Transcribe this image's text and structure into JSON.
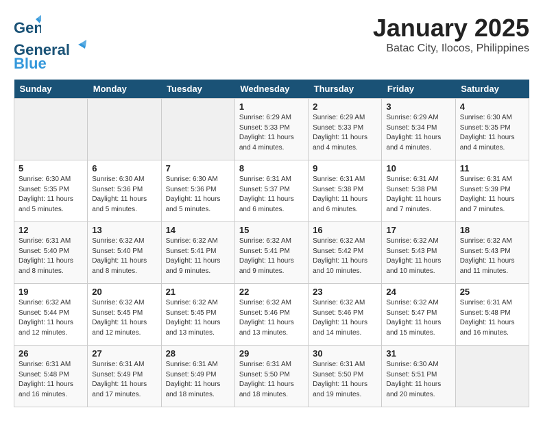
{
  "header": {
    "logo_line1": "General",
    "logo_line2": "Blue",
    "title": "January 2025",
    "subtitle": "Batac City, Ilocos, Philippines"
  },
  "weekdays": [
    "Sunday",
    "Monday",
    "Tuesday",
    "Wednesday",
    "Thursday",
    "Friday",
    "Saturday"
  ],
  "weeks": [
    [
      {
        "day": "",
        "info": ""
      },
      {
        "day": "",
        "info": ""
      },
      {
        "day": "",
        "info": ""
      },
      {
        "day": "1",
        "info": "Sunrise: 6:29 AM\nSunset: 5:33 PM\nDaylight: 11 hours\nand 4 minutes."
      },
      {
        "day": "2",
        "info": "Sunrise: 6:29 AM\nSunset: 5:33 PM\nDaylight: 11 hours\nand 4 minutes."
      },
      {
        "day": "3",
        "info": "Sunrise: 6:29 AM\nSunset: 5:34 PM\nDaylight: 11 hours\nand 4 minutes."
      },
      {
        "day": "4",
        "info": "Sunrise: 6:30 AM\nSunset: 5:35 PM\nDaylight: 11 hours\nand 4 minutes."
      }
    ],
    [
      {
        "day": "5",
        "info": "Sunrise: 6:30 AM\nSunset: 5:35 PM\nDaylight: 11 hours\nand 5 minutes."
      },
      {
        "day": "6",
        "info": "Sunrise: 6:30 AM\nSunset: 5:36 PM\nDaylight: 11 hours\nand 5 minutes."
      },
      {
        "day": "7",
        "info": "Sunrise: 6:30 AM\nSunset: 5:36 PM\nDaylight: 11 hours\nand 5 minutes."
      },
      {
        "day": "8",
        "info": "Sunrise: 6:31 AM\nSunset: 5:37 PM\nDaylight: 11 hours\nand 6 minutes."
      },
      {
        "day": "9",
        "info": "Sunrise: 6:31 AM\nSunset: 5:38 PM\nDaylight: 11 hours\nand 6 minutes."
      },
      {
        "day": "10",
        "info": "Sunrise: 6:31 AM\nSunset: 5:38 PM\nDaylight: 11 hours\nand 7 minutes."
      },
      {
        "day": "11",
        "info": "Sunrise: 6:31 AM\nSunset: 5:39 PM\nDaylight: 11 hours\nand 7 minutes."
      }
    ],
    [
      {
        "day": "12",
        "info": "Sunrise: 6:31 AM\nSunset: 5:40 PM\nDaylight: 11 hours\nand 8 minutes."
      },
      {
        "day": "13",
        "info": "Sunrise: 6:32 AM\nSunset: 5:40 PM\nDaylight: 11 hours\nand 8 minutes."
      },
      {
        "day": "14",
        "info": "Sunrise: 6:32 AM\nSunset: 5:41 PM\nDaylight: 11 hours\nand 9 minutes."
      },
      {
        "day": "15",
        "info": "Sunrise: 6:32 AM\nSunset: 5:41 PM\nDaylight: 11 hours\nand 9 minutes."
      },
      {
        "day": "16",
        "info": "Sunrise: 6:32 AM\nSunset: 5:42 PM\nDaylight: 11 hours\nand 10 minutes."
      },
      {
        "day": "17",
        "info": "Sunrise: 6:32 AM\nSunset: 5:43 PM\nDaylight: 11 hours\nand 10 minutes."
      },
      {
        "day": "18",
        "info": "Sunrise: 6:32 AM\nSunset: 5:43 PM\nDaylight: 11 hours\nand 11 minutes."
      }
    ],
    [
      {
        "day": "19",
        "info": "Sunrise: 6:32 AM\nSunset: 5:44 PM\nDaylight: 11 hours\nand 12 minutes."
      },
      {
        "day": "20",
        "info": "Sunrise: 6:32 AM\nSunset: 5:45 PM\nDaylight: 11 hours\nand 12 minutes."
      },
      {
        "day": "21",
        "info": "Sunrise: 6:32 AM\nSunset: 5:45 PM\nDaylight: 11 hours\nand 13 minutes."
      },
      {
        "day": "22",
        "info": "Sunrise: 6:32 AM\nSunset: 5:46 PM\nDaylight: 11 hours\nand 13 minutes."
      },
      {
        "day": "23",
        "info": "Sunrise: 6:32 AM\nSunset: 5:46 PM\nDaylight: 11 hours\nand 14 minutes."
      },
      {
        "day": "24",
        "info": "Sunrise: 6:32 AM\nSunset: 5:47 PM\nDaylight: 11 hours\nand 15 minutes."
      },
      {
        "day": "25",
        "info": "Sunrise: 6:31 AM\nSunset: 5:48 PM\nDaylight: 11 hours\nand 16 minutes."
      }
    ],
    [
      {
        "day": "26",
        "info": "Sunrise: 6:31 AM\nSunset: 5:48 PM\nDaylight: 11 hours\nand 16 minutes."
      },
      {
        "day": "27",
        "info": "Sunrise: 6:31 AM\nSunset: 5:49 PM\nDaylight: 11 hours\nand 17 minutes."
      },
      {
        "day": "28",
        "info": "Sunrise: 6:31 AM\nSunset: 5:49 PM\nDaylight: 11 hours\nand 18 minutes."
      },
      {
        "day": "29",
        "info": "Sunrise: 6:31 AM\nSunset: 5:50 PM\nDaylight: 11 hours\nand 18 minutes."
      },
      {
        "day": "30",
        "info": "Sunrise: 6:31 AM\nSunset: 5:50 PM\nDaylight: 11 hours\nand 19 minutes."
      },
      {
        "day": "31",
        "info": "Sunrise: 6:30 AM\nSunset: 5:51 PM\nDaylight: 11 hours\nand 20 minutes."
      },
      {
        "day": "",
        "info": ""
      }
    ]
  ]
}
